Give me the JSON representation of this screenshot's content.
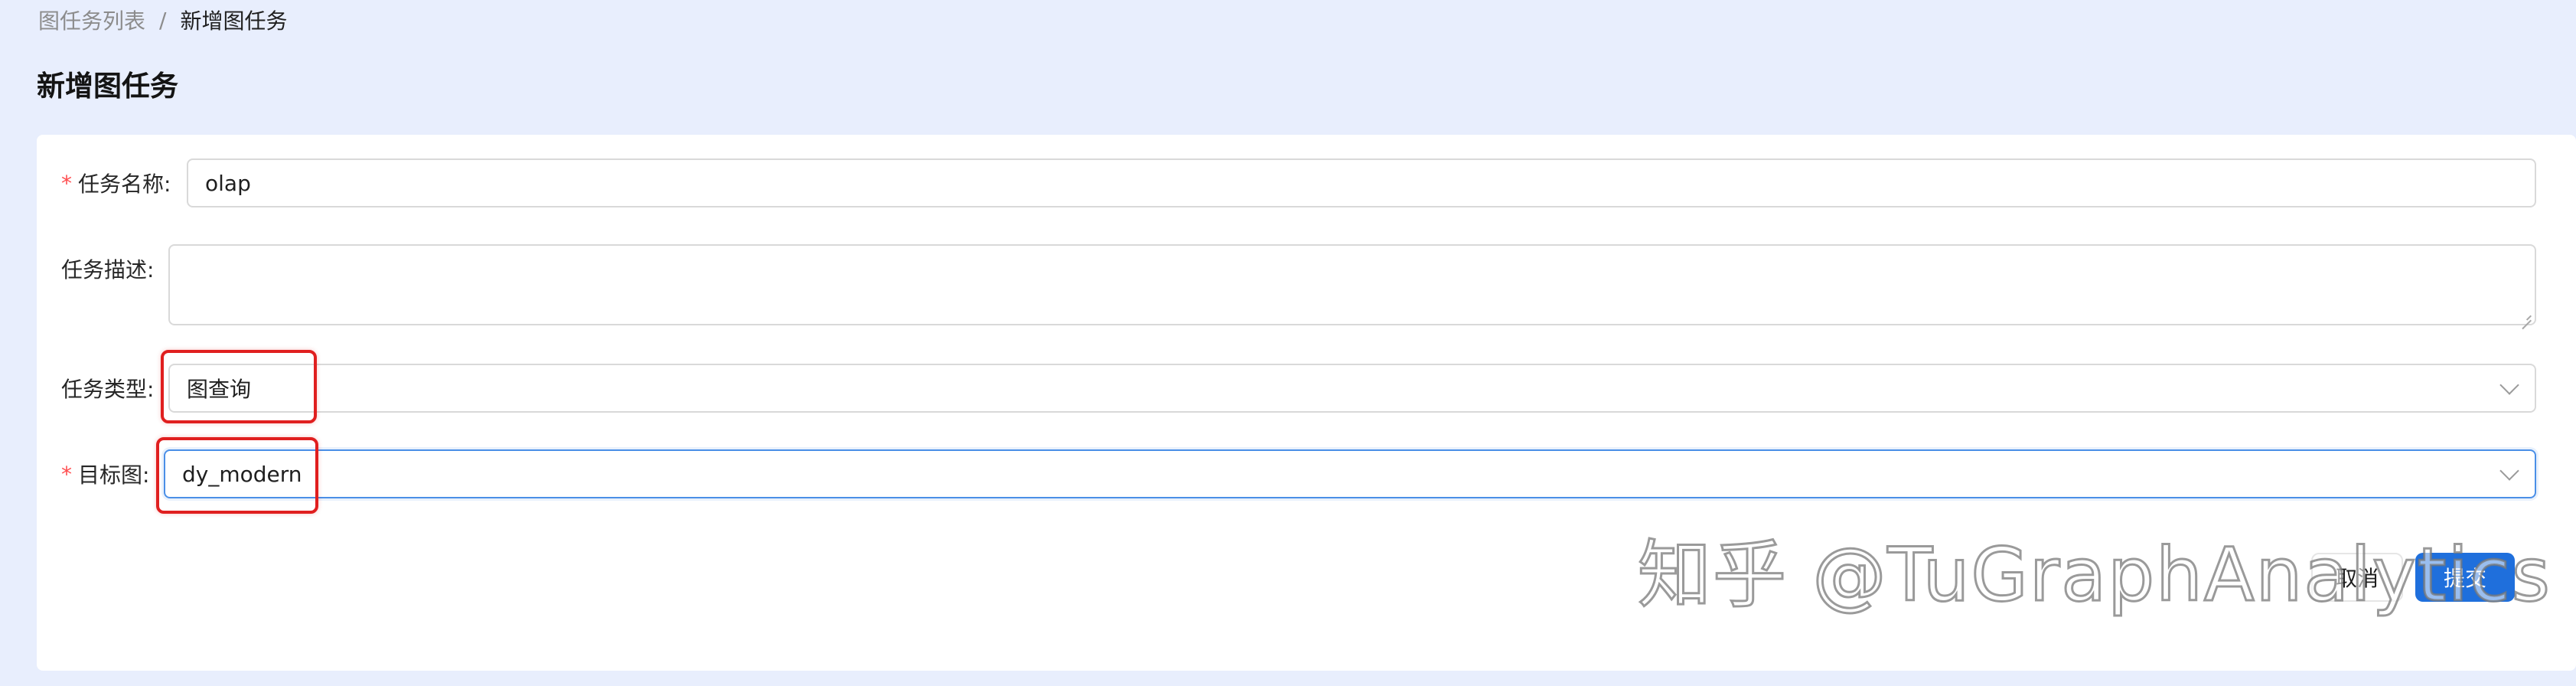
{
  "breadcrumb": {
    "parent": "图任务列表",
    "separator": "/",
    "current": "新增图任务"
  },
  "page_title": "新增图任务",
  "form": {
    "task_name": {
      "label": "任务名称:",
      "required": true,
      "value": "olap"
    },
    "task_description": {
      "label": "任务描述:",
      "required": false,
      "value": ""
    },
    "task_type": {
      "label": "任务类型:",
      "required": false,
      "value": "图查询",
      "icon": "chevron-down-icon"
    },
    "target_graph": {
      "label": "目标图:",
      "required": true,
      "value": "dy_modern",
      "icon": "chevron-down-icon"
    }
  },
  "actions": {
    "cancel_label": "取消",
    "submit_label": "提交"
  },
  "watermark": "知乎 @TuGraphAnalytics",
  "colors": {
    "background": "#e8eefd",
    "card": "#ffffff",
    "required_mark": "#ff4d4f",
    "focus_border": "#4a8fe7",
    "primary_button": "#1f6fdc",
    "annotation_highlight": "#e01f1f"
  }
}
